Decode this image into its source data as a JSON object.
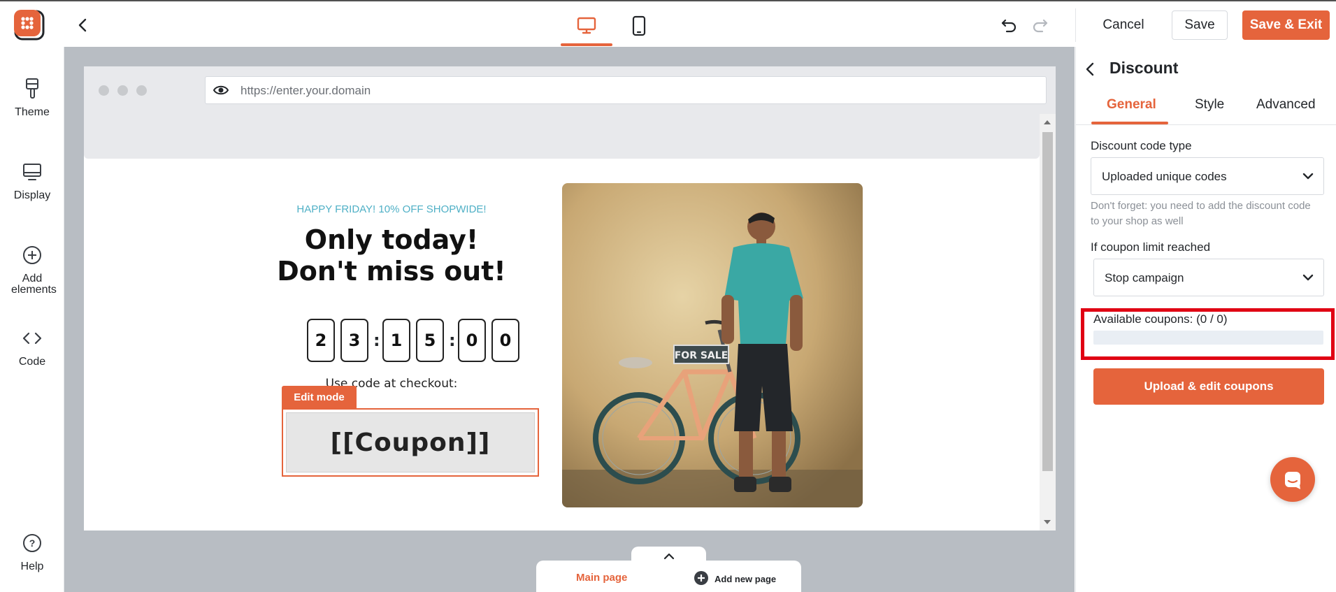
{
  "brand": {
    "accent": "#e5643c",
    "logo_icon": "om-logo-icon"
  },
  "topbar": {
    "back_icon": "chevron-left-icon",
    "devices": [
      {
        "icon": "desktop-icon",
        "active": true
      },
      {
        "icon": "mobile-icon",
        "active": false
      }
    ],
    "undo_icon": "undo-icon",
    "redo_icon": "redo-icon",
    "cancel_label": "Cancel",
    "save_label": "Save",
    "save_exit_label": "Save & Exit"
  },
  "sidebar": {
    "items": [
      {
        "label": "Theme",
        "icon": "brush-icon"
      },
      {
        "label": "Display",
        "icon": "monitor-icon"
      },
      {
        "label": "Add elements",
        "icon": "plus-circle-icon"
      },
      {
        "label": "Code",
        "icon": "code-icon"
      }
    ],
    "help": {
      "label": "Help",
      "icon": "help-icon"
    }
  },
  "browser": {
    "url": "https://enter.your.domain",
    "url_icon": "eye-icon"
  },
  "popup": {
    "eyebrow": "HAPPY FRIDAY! 10% OFF SHOPWIDE!",
    "headline_line1": "Only today!",
    "headline_line2": "Don't miss out!",
    "countdown": [
      "2",
      "3",
      "1",
      "5",
      "0",
      "0"
    ],
    "separator": ":",
    "checkout_text": "Use code at checkout:",
    "edit_mode_label": "Edit mode",
    "coupon_text": "[[Coupon]]",
    "image_sign": "FOR SALE"
  },
  "pages": {
    "handle_icon": "chevron-up-icon",
    "main_label": "Main page",
    "add_label": "Add new page",
    "add_icon": "plus-circle-filled-icon"
  },
  "panel": {
    "title": "Discount",
    "tabs": [
      {
        "label": "General",
        "active": true
      },
      {
        "label": "Style",
        "active": false
      },
      {
        "label": "Advanced",
        "active": false
      }
    ],
    "discount_type_label": "Discount code type",
    "discount_type_value": "Uploaded unique codes",
    "hint": "Don't forget: you need to add the discount code to your shop as well",
    "limit_label": "If coupon limit reached",
    "limit_value": "Stop campaign",
    "available_label": "Available coupons: (0 / 0)",
    "available_used": 0,
    "available_total": 0,
    "upload_label": "Upload & edit coupons",
    "chat_icon": "chat-icon"
  }
}
